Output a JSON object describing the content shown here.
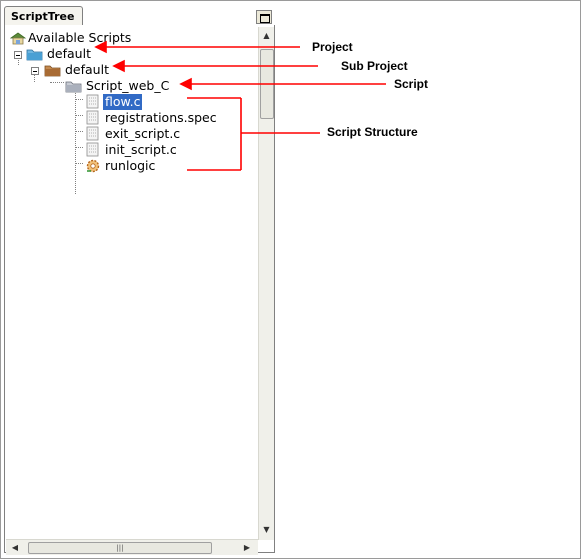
{
  "panel": {
    "tab_label": "ScriptTree"
  },
  "tree": {
    "root_label": "Available Scripts",
    "project_label": "default",
    "subproject_label": "default",
    "script_label": "Script_web_C",
    "files": [
      {
        "label": "flow.c",
        "selected": true
      },
      {
        "label": "registrations.spec",
        "selected": false
      },
      {
        "label": "exit_script.c",
        "selected": false
      },
      {
        "label": "init_script.c",
        "selected": false
      },
      {
        "label": "runlogic",
        "selected": false
      }
    ]
  },
  "annotations": {
    "project": "Project",
    "sub_project": "Sub Project",
    "script": "Script",
    "script_structure": "Script Structure",
    "arrow_color": "#ff0000"
  },
  "icons": {
    "root": "network-folder-icon",
    "project": "blue-folder-icon",
    "subproject": "brown-folder-icon",
    "script": "gray-folder-icon",
    "file": "script-file-icon",
    "runlogic": "runlogic-gear-icon"
  }
}
